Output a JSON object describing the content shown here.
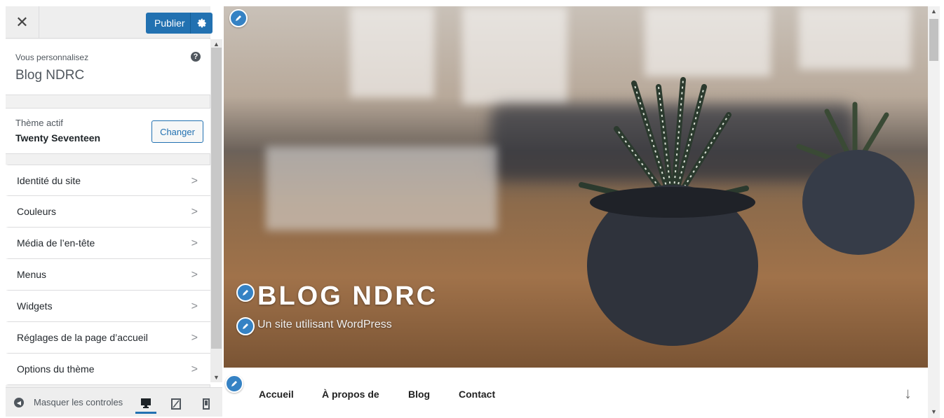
{
  "header": {
    "close_label": "✕",
    "publish_label": "Publier"
  },
  "customizing": {
    "label": "Vous personnalisez",
    "site_name": "Blog NDRC",
    "help": "?"
  },
  "theme": {
    "active_label": "Thème actif",
    "name": "Twenty Seventeen",
    "change_label": "Changer"
  },
  "menu": {
    "items": [
      {
        "label": "Identité du site"
      },
      {
        "label": "Couleurs"
      },
      {
        "label": "Média de l’en-tête"
      },
      {
        "label": "Menus"
      },
      {
        "label": "Widgets"
      },
      {
        "label": "Réglages de la page d’accueil"
      },
      {
        "label": "Options du thème"
      }
    ]
  },
  "footer": {
    "hide_label": "Masquer les controles",
    "devices": [
      "desktop-icon",
      "tablet-icon",
      "mobile-icon"
    ]
  },
  "preview": {
    "site_title": "BLOG NDRC",
    "tagline": "Un site utilisant WordPress",
    "nav": [
      "Accueil",
      "À propos de",
      "Blog",
      "Contact"
    ],
    "scroll_icon": "↓"
  },
  "colors": {
    "accent": "#2271b1",
    "pencil": "#3582c4"
  }
}
